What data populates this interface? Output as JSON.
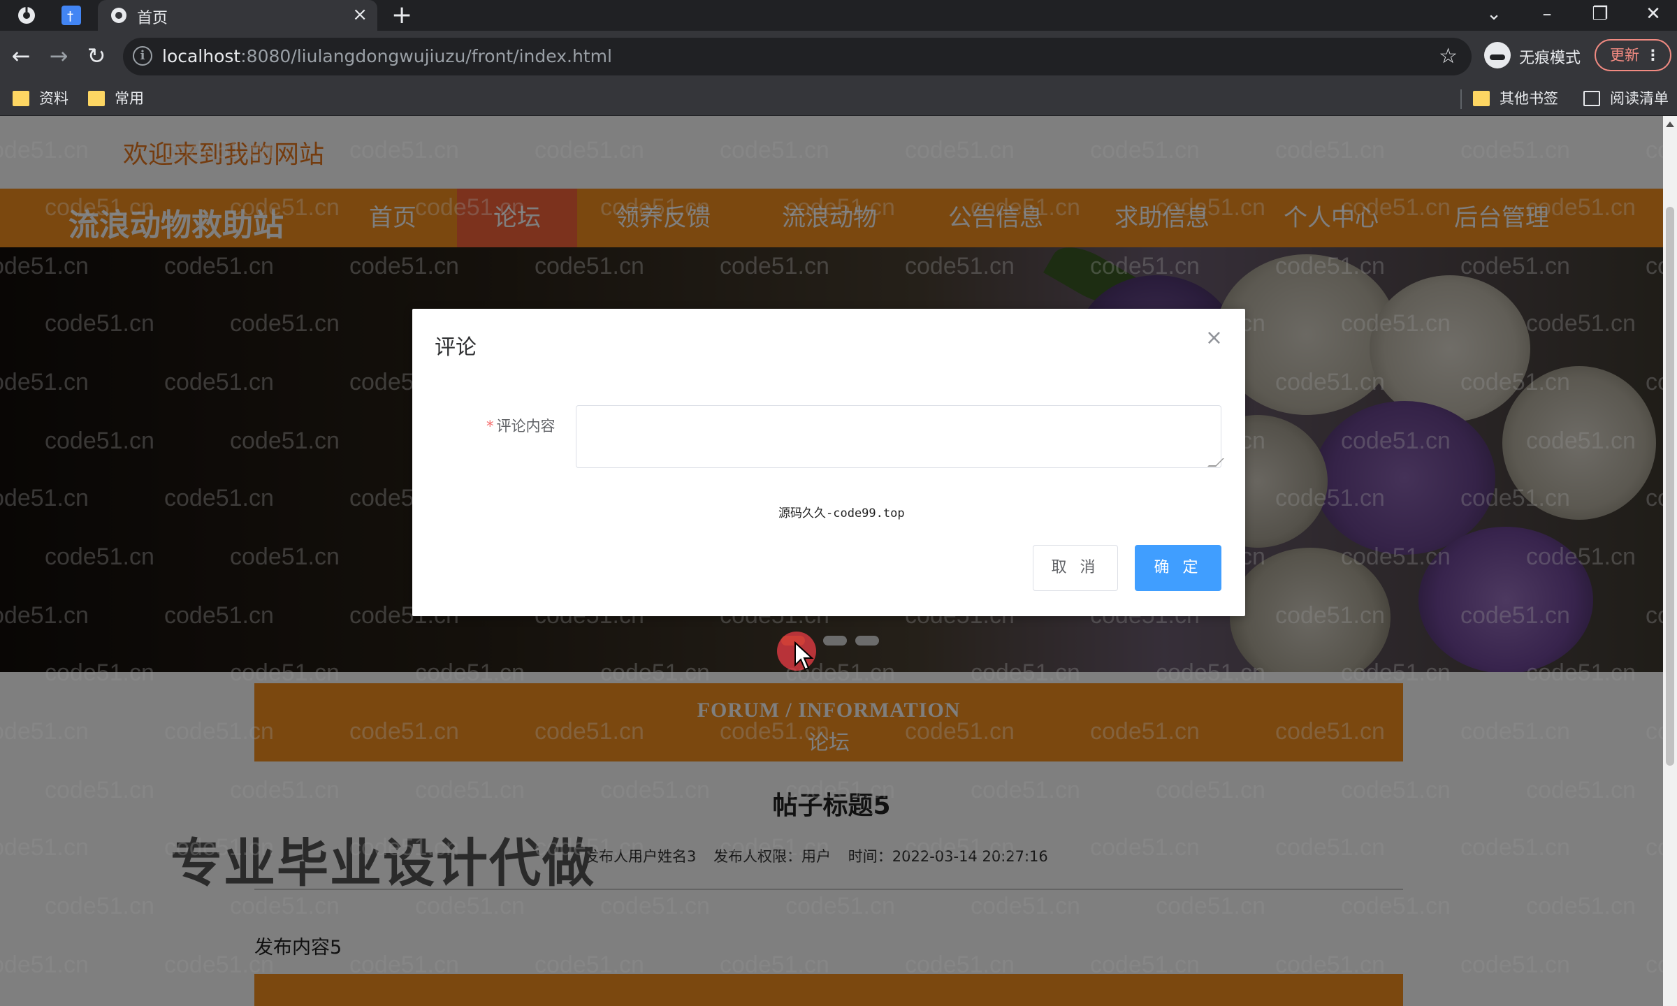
{
  "browser": {
    "tab_title": "首页",
    "tab_close": "×",
    "new_tab": "+",
    "url_host": "localhost",
    "url_rest": ":8080/liulangdongwujiuzu/front/index.html",
    "incognito_label": "无痕模式",
    "update_label": "更新",
    "bookmarks": [
      "资料",
      "常用"
    ],
    "bookmarks_right": [
      "其他书签",
      "阅读清单"
    ],
    "window_controls": [
      "⌄",
      "–",
      "❐",
      "✕"
    ]
  },
  "site": {
    "welcome": "欢迎来到我的网站",
    "brand": "流浪动物救助站",
    "nav": [
      "首页",
      "论坛",
      "领养反馈",
      "流浪动物",
      "公告信息",
      "求助信息",
      "个人中心",
      "后台管理"
    ],
    "active_nav": "论坛"
  },
  "section": {
    "title_en": "FORUM / INFORMATION",
    "title_cn": "论坛"
  },
  "post": {
    "title": "帖子标题5",
    "author": "发布人用户姓名3",
    "role": "发布人权限：用户",
    "time": "时间：2022-03-14 20:27:16",
    "content": "发布内容5"
  },
  "ad_text": "专业毕业设计代做",
  "modal": {
    "title": "评论",
    "close": "×",
    "label_required": "*",
    "label": "评论内容",
    "textarea_value": "",
    "source_note": "源码久久-code99.top",
    "cancel": "取 消",
    "confirm": "确 定"
  },
  "watermark": "code51.cn",
  "colors": {
    "brand_orange": "#f7901e",
    "nav_active": "#f9643a",
    "primary_blue": "#409eff",
    "welcome_text": "#e9781f"
  },
  "icons": [
    "chrome-icon",
    "extension-icon",
    "globe-icon",
    "back-icon",
    "forward-icon",
    "reload-icon",
    "info-icon",
    "star-icon",
    "incognito-icon",
    "folder-icon",
    "reading-list-icon"
  ]
}
